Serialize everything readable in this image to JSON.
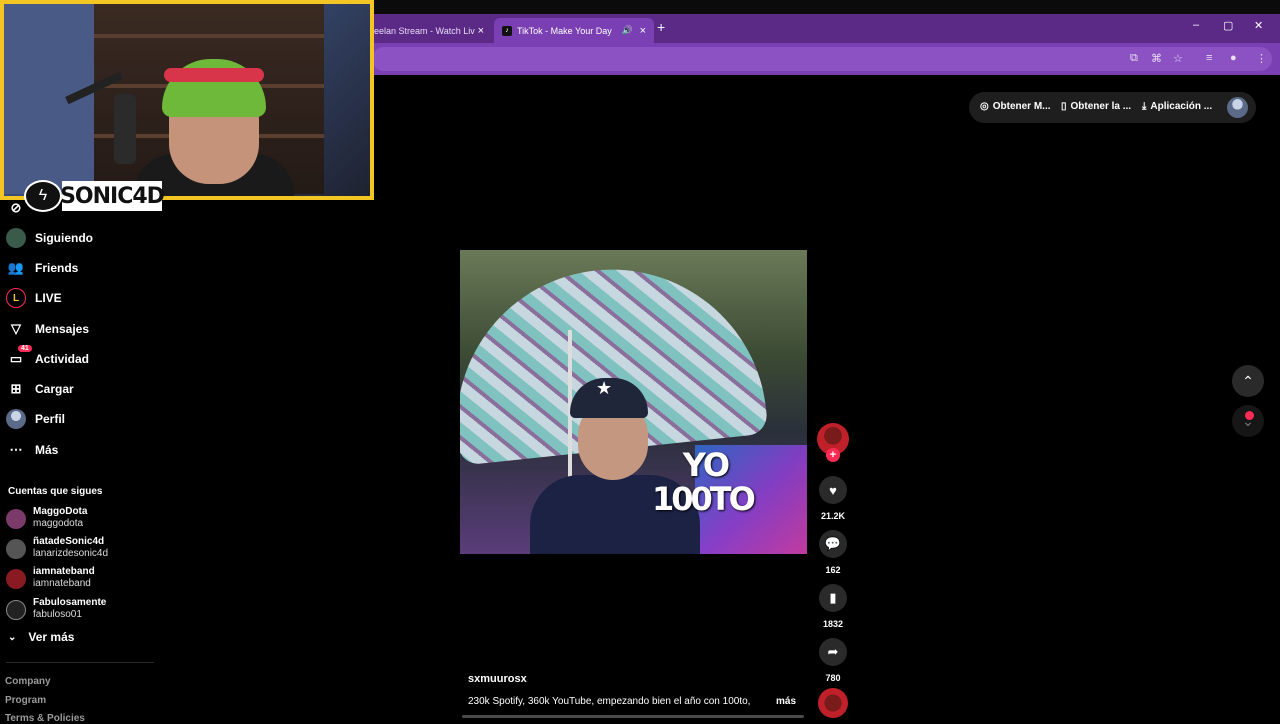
{
  "browser": {
    "tabs": [
      {
        "label": "Keelan Stream - Watch Liv",
        "active": false
      },
      {
        "label": "TikTok - Make Your Day",
        "active": true
      }
    ],
    "new_tab": "+",
    "controls": {
      "minimize": "–",
      "maximize": "▢",
      "close": "✕"
    },
    "toolbar_icons": [
      "cast-icon",
      "translate-icon",
      "bookmark-star-icon",
      "media-icon",
      "extension-icon",
      "menu-icon"
    ]
  },
  "stream_overlay": {
    "channel_name": "SONIC4D",
    "border_color": "#f3c623"
  },
  "sidebar": {
    "items": [
      {
        "label": "Siguiendo",
        "icon": "following-avatar-icon"
      },
      {
        "label": "Friends",
        "icon": "friends-icon"
      },
      {
        "label": "LIVE",
        "icon": "live-icon"
      },
      {
        "label": "Mensajes",
        "icon": "messages-icon"
      },
      {
        "label": "Actividad",
        "icon": "activity-icon",
        "badge": "41"
      },
      {
        "label": "Cargar",
        "icon": "upload-icon"
      },
      {
        "label": "Perfil",
        "icon": "profile-icon"
      },
      {
        "label": "Más",
        "icon": "more-icon"
      }
    ],
    "following_title": "Cuentas que sigues",
    "following": [
      {
        "name": "MaggoDota",
        "handle": "maggodota"
      },
      {
        "name": "ñatadeSonic4d",
        "handle": "lanarizdesonic4d"
      },
      {
        "name": "iamnateband",
        "handle": "iamnateband"
      },
      {
        "name": "Fabulosamente",
        "handle": "fabuloso01"
      }
    ],
    "see_more": "Ver más",
    "footer": [
      "Company",
      "Program",
      "Terms & Policies"
    ]
  },
  "header_actions": [
    {
      "label": "Obtener M...",
      "icon": "coins-icon"
    },
    {
      "label": "Obtener la ...",
      "icon": "phone-icon"
    },
    {
      "label": "Aplicación ...",
      "icon": "download-icon"
    }
  ],
  "video": {
    "overlay_text_line1": "YO",
    "overlay_text_line2": "100TO",
    "author": "sxmuurosx",
    "description": "230k Spotify, 360k YouTube, empezando bien el año con 100to,",
    "more": "más",
    "likes": "21.2K",
    "comments": "162",
    "saves": "1832",
    "shares": "780",
    "accent_color": "#fe2c55"
  }
}
